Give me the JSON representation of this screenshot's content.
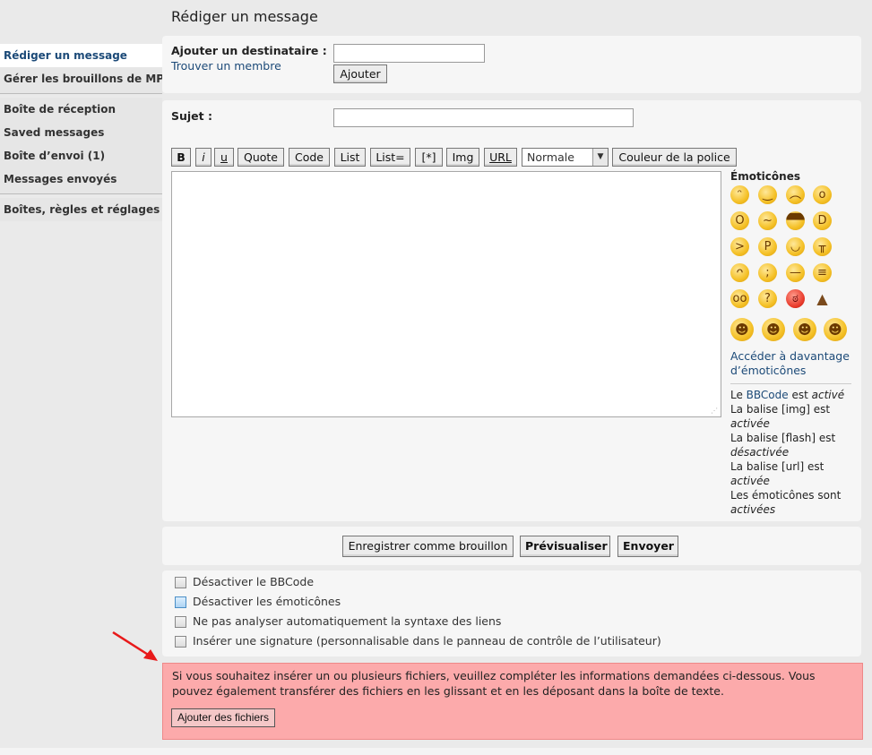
{
  "page_title": "Rédiger un message",
  "sidebar": {
    "items": [
      {
        "label": "Rédiger un message"
      },
      {
        "label": "Gérer les brouillons de MP"
      },
      {
        "label": "Boîte de réception"
      },
      {
        "label": "Saved messages"
      },
      {
        "label": "Boîte d’envoi (1)"
      },
      {
        "label": "Messages envoyés"
      },
      {
        "label": "Boîtes, règles et réglages"
      }
    ]
  },
  "recipient": {
    "label": "Ajouter un destinataire :",
    "find_member": "Trouver un membre",
    "value": "",
    "add_button": "Ajouter"
  },
  "subject": {
    "label": "Sujet :",
    "value": ""
  },
  "toolbar": {
    "bold": "B",
    "italic": "i",
    "underline": "u",
    "quote": "Quote",
    "code": "Code",
    "list": "List",
    "list_eq": "List=",
    "list_item": "[*]",
    "img": "Img",
    "url": "URL",
    "font_size": "Normale",
    "font_color": "Couleur de la police"
  },
  "message": {
    "value": ""
  },
  "smilies": {
    "title": "Émoticônes",
    "icons": [
      "grin-icon",
      "smile-icon",
      "sad-icon",
      "surprised-icon",
      "shocked-icon",
      "confused-icon",
      "cool-icon",
      "laughing-icon",
      "mad-icon",
      "razz-icon",
      "blush-icon",
      "cry-icon",
      "rolleyes-icon",
      "wink-icon",
      "neutral-icon",
      "grimace-icon",
      "geek-icon",
      "thinking-icon",
      "angry-icon",
      "poop-icon",
      "sherlock-icon",
      "cowboy-icon",
      "asian-icon",
      "detective-icon"
    ],
    "more_link": "Accéder à davantage d’émoticônes"
  },
  "bbcode_info": {
    "line1_prefix": "Le ",
    "line1_link": "BBCode",
    "line1_mid": " est ",
    "line1_state": "activé",
    "line2": "La balise [img] est",
    "line2_state": "activée",
    "line3": "La balise [flash] est",
    "line3_state": "désactivée",
    "line4": "La balise [url] est",
    "line4_state": "activée",
    "line5": "Les émoticônes sont",
    "line5_state": "activées"
  },
  "actions": {
    "save_draft": "Enregistrer comme brouillon",
    "preview": "Prévisualiser",
    "send": "Envoyer"
  },
  "options": [
    {
      "label": "Désactiver le BBCode"
    },
    {
      "label": "Désactiver les émoticônes"
    },
    {
      "label": "Ne pas analyser automatiquement la syntaxe des liens"
    },
    {
      "label": "Insérer une signature (personnalisable dans le panneau de contrôle de l’utilisateur)"
    }
  ],
  "attachments": {
    "notice": "Si vous souhaitez insérer un ou plusieurs fichiers, veuillez compléter les informations demandées ci-dessous. Vous pouvez également transférer des fichiers en les glissant et en les déposant dans la boîte de texte.",
    "add_button": "Ajouter des fichiers"
  },
  "colors": {
    "notice_bg": "#fcaaab",
    "link": "#1c4a78",
    "arrow": "#e8191a"
  }
}
